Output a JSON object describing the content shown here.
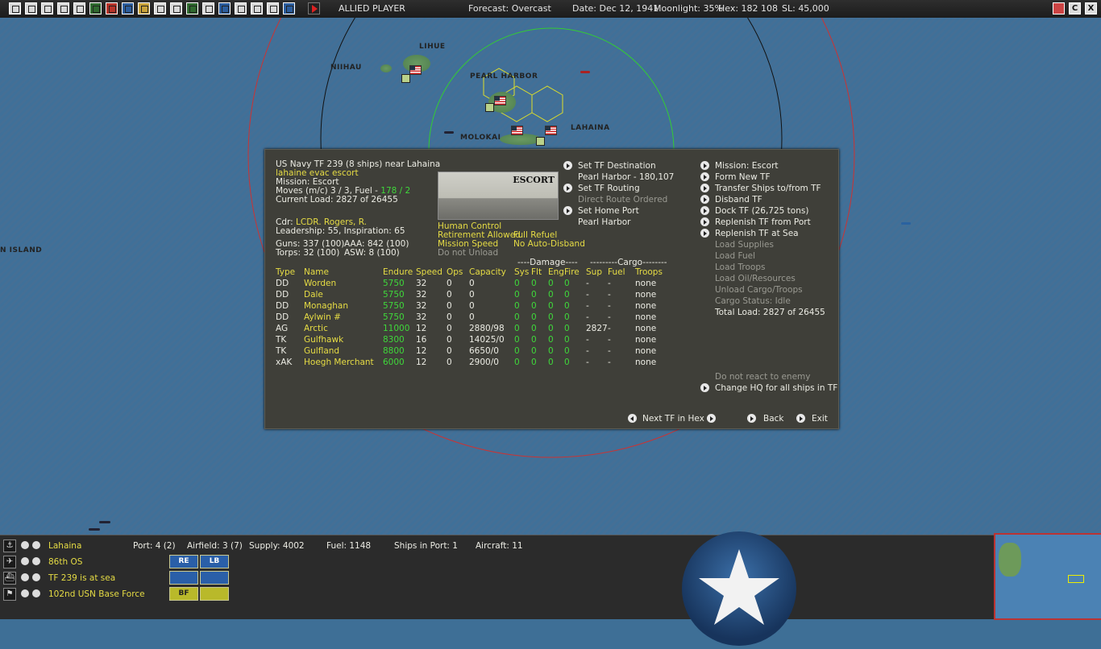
{
  "topbar": {
    "side": "ALLIED PLAYER",
    "forecast": "Forecast: Overcast",
    "date": "Date: Dec 12, 1941",
    "moonlight": "Moonlight: 35%",
    "hex": "Hex: 182 108",
    "sl": "SL: 45,000",
    "right_c": "C",
    "right_x": "X"
  },
  "map": {
    "labels": {
      "lihue": "LIHUE",
      "niihau": "NIIHAU",
      "pearl": "PEARL HARBOR",
      "lahaina": "LAHAINA",
      "molokai": "MOLOKAI",
      "island": "N ISLAND"
    }
  },
  "tf": {
    "header": "US Navy TF 239 (8 ships) near Lahaina",
    "name": "lahaine evac escort",
    "mission": "Mission: Escort",
    "moves_prefix": "Moves (m/c) 3 / 3, Fuel -",
    "fuel_value": "178 / 2",
    "current_load": "Current Load: 2827 of 26455",
    "cdr_prefix": "Cdr:",
    "cdr_name": "LCDR. Rogers, R.",
    "leadership": "Leadership: 55, Inspiration: 65",
    "guns": "Guns: 337 (100)",
    "aaa": "AAA: 842 (100)",
    "torps": "Torps: 32 (100)",
    "asw": "ASW: 8 (100)",
    "escort_label": "ESCORT",
    "human_control": "Human Control",
    "retirement": "Retirement Allowed",
    "full_refuel": "Full Refuel",
    "mission_speed": "Mission Speed",
    "no_auto_disband": "No Auto-Disband",
    "do_not_unload": "Do not Unload"
  },
  "mid_actions": {
    "set_dest": "Set TF Destination",
    "dest_value": "Pearl Harbor - 180,107",
    "set_routing": "Set TF Routing",
    "direct_route": "Direct Route Ordered",
    "set_home": "Set Home Port",
    "home_value": "Pearl Harbor"
  },
  "right_actions": {
    "mission": "Mission: Escort",
    "form_new": "Form New TF",
    "transfer": "Transfer Ships to/from TF",
    "disband": "Disband TF",
    "dock": "Dock TF (26,725 tons)",
    "replenish_port": "Replenish TF from Port",
    "replenish_sea": "Replenish TF at Sea",
    "load_supplies": "Load Supplies",
    "load_fuel": "Load Fuel",
    "load_troops": "Load Troops",
    "load_oil": "Load Oil/Resources",
    "unload": "Unload Cargo/Troops",
    "cargo_status": "Cargo Status: Idle",
    "total_load": "Total Load: 2827 of 26455",
    "no_react": "Do not react to enemy",
    "change_hq": "Change HQ for all ships in TF"
  },
  "bottom_nav": {
    "next_tf": "Next TF in Hex",
    "back": "Back",
    "exit": "Exit"
  },
  "table": {
    "group_damage": "----Damage----",
    "group_cargo": "---------Cargo--------",
    "headers": [
      "Type",
      "Name",
      "Endure",
      "Speed",
      "Ops",
      "Capacity",
      "Sys",
      "Flt",
      "Eng",
      "Fire",
      "Sup",
      "Fuel",
      "Troops"
    ],
    "rows": [
      [
        "DD",
        "Worden",
        "5750",
        "32",
        "0",
        "0",
        "0",
        "0",
        "0",
        "0",
        "-",
        "-",
        "none"
      ],
      [
        "DD",
        "Dale",
        "5750",
        "32",
        "0",
        "0",
        "0",
        "0",
        "0",
        "0",
        "-",
        "-",
        "none"
      ],
      [
        "DD",
        "Monaghan",
        "5750",
        "32",
        "0",
        "0",
        "0",
        "0",
        "0",
        "0",
        "-",
        "-",
        "none"
      ],
      [
        "DD",
        "Aylwin #",
        "5750",
        "32",
        "0",
        "0",
        "0",
        "0",
        "0",
        "0",
        "-",
        "-",
        "none"
      ],
      [
        "AG",
        "Arctic",
        "11000",
        "12",
        "0",
        "2880/98",
        "0",
        "0",
        "0",
        "0",
        "2827",
        "-",
        "none"
      ],
      [
        "TK",
        "Gulfhawk",
        "8300",
        "16",
        "0",
        "14025/0",
        "0",
        "0",
        "0",
        "0",
        "-",
        "-",
        "none"
      ],
      [
        "TK",
        "Gulfland",
        "8800",
        "12",
        "0",
        "6650/0",
        "0",
        "0",
        "0",
        "0",
        "-",
        "-",
        "none"
      ],
      [
        "xAK",
        "Hoegh Merchant",
        "6000",
        "12",
        "0",
        "2900/0",
        "0",
        "0",
        "0",
        "0",
        "-",
        "-",
        "none"
      ]
    ]
  },
  "bottom": {
    "base": "Lahaina",
    "port": "Port: 4 (2)",
    "airfield": "Airfield: 3 (7)",
    "supply": "Supply: 4002",
    "fuel": "Fuel: 1148",
    "ships_in_port": "Ships in Port: 1",
    "aircraft": "Aircraft: 11",
    "air_unit": "86th OS",
    "tf_status": "TF 239 is at sea",
    "base_force": "102nd USN Base Force",
    "btn_re": "RE",
    "btn_lb": "LB",
    "btn_bf": "BF"
  }
}
